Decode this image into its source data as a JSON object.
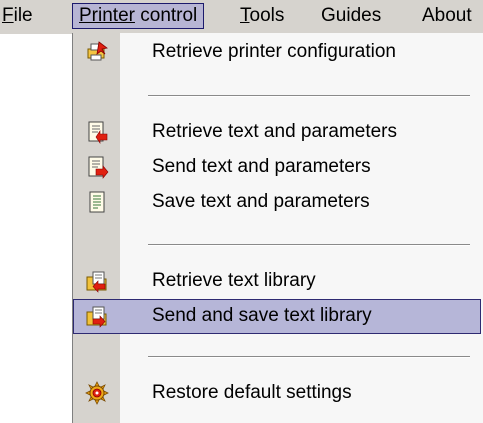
{
  "menubar": {
    "file": {
      "accel": "F",
      "rest": "ile"
    },
    "printer_control": {
      "accel": "Printer",
      "rest": " control"
    },
    "tools": {
      "accel": "T",
      "rest": "ools"
    },
    "guides": "Guides",
    "about": "About"
  },
  "dropdown": {
    "items": [
      {
        "label": "Retrieve printer configuration",
        "icon": "printer-config-icon"
      },
      {
        "label": "Retrieve text and parameters",
        "icon": "retrieve-document-icon"
      },
      {
        "label": "Send text and parameters",
        "icon": "send-document-icon"
      },
      {
        "label": "Save text and parameters",
        "icon": "save-document-icon"
      },
      {
        "label": "Retrieve text library",
        "icon": "retrieve-library-icon"
      },
      {
        "label": "Send and save text library",
        "icon": "send-library-icon",
        "highlighted": true
      },
      {
        "label": "Restore default settings",
        "icon": "restore-defaults-icon"
      }
    ]
  },
  "colors": {
    "menubar_bg": "#d6d3ce",
    "highlight_bg": "#b6b6d8",
    "highlight_border": "#2e2a72",
    "menu_bg": "#f7f7f7"
  }
}
